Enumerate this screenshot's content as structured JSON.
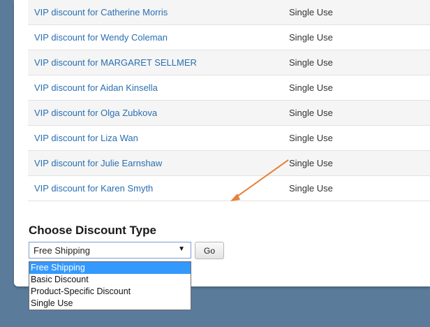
{
  "discounts": [
    {
      "name": "VIP discount for Catherine Morris",
      "type": "Single Use"
    },
    {
      "name": "VIP discount for Wendy Coleman",
      "type": "Single Use"
    },
    {
      "name": "VIP discount for MARGARET SELLMER",
      "type": "Single Use"
    },
    {
      "name": "VIP discount for Aidan Kinsella",
      "type": "Single Use"
    },
    {
      "name": "VIP discount for Olga Zubkova",
      "type": "Single Use"
    },
    {
      "name": "VIP discount for Liza Wan",
      "type": "Single Use"
    },
    {
      "name": "VIP discount for Julie Earnshaw",
      "type": "Single Use"
    },
    {
      "name": "VIP discount for Karen Smyth",
      "type": "Single Use"
    }
  ],
  "choose_section": {
    "title": "Choose Discount Type",
    "selected_value": "Free Shipping",
    "go_label": "Go",
    "options": [
      "Free Shipping",
      "Basic Discount",
      "Product-Specific Discount",
      "Single Use"
    ]
  },
  "colors": {
    "link": "#2a6fb0",
    "background": "#5b7b9a",
    "selection": "#3399ff",
    "arrow": "#e8813a"
  },
  "icons": {
    "select_chevron": "chevron-down-icon",
    "annotation": "arrow-annotation"
  }
}
